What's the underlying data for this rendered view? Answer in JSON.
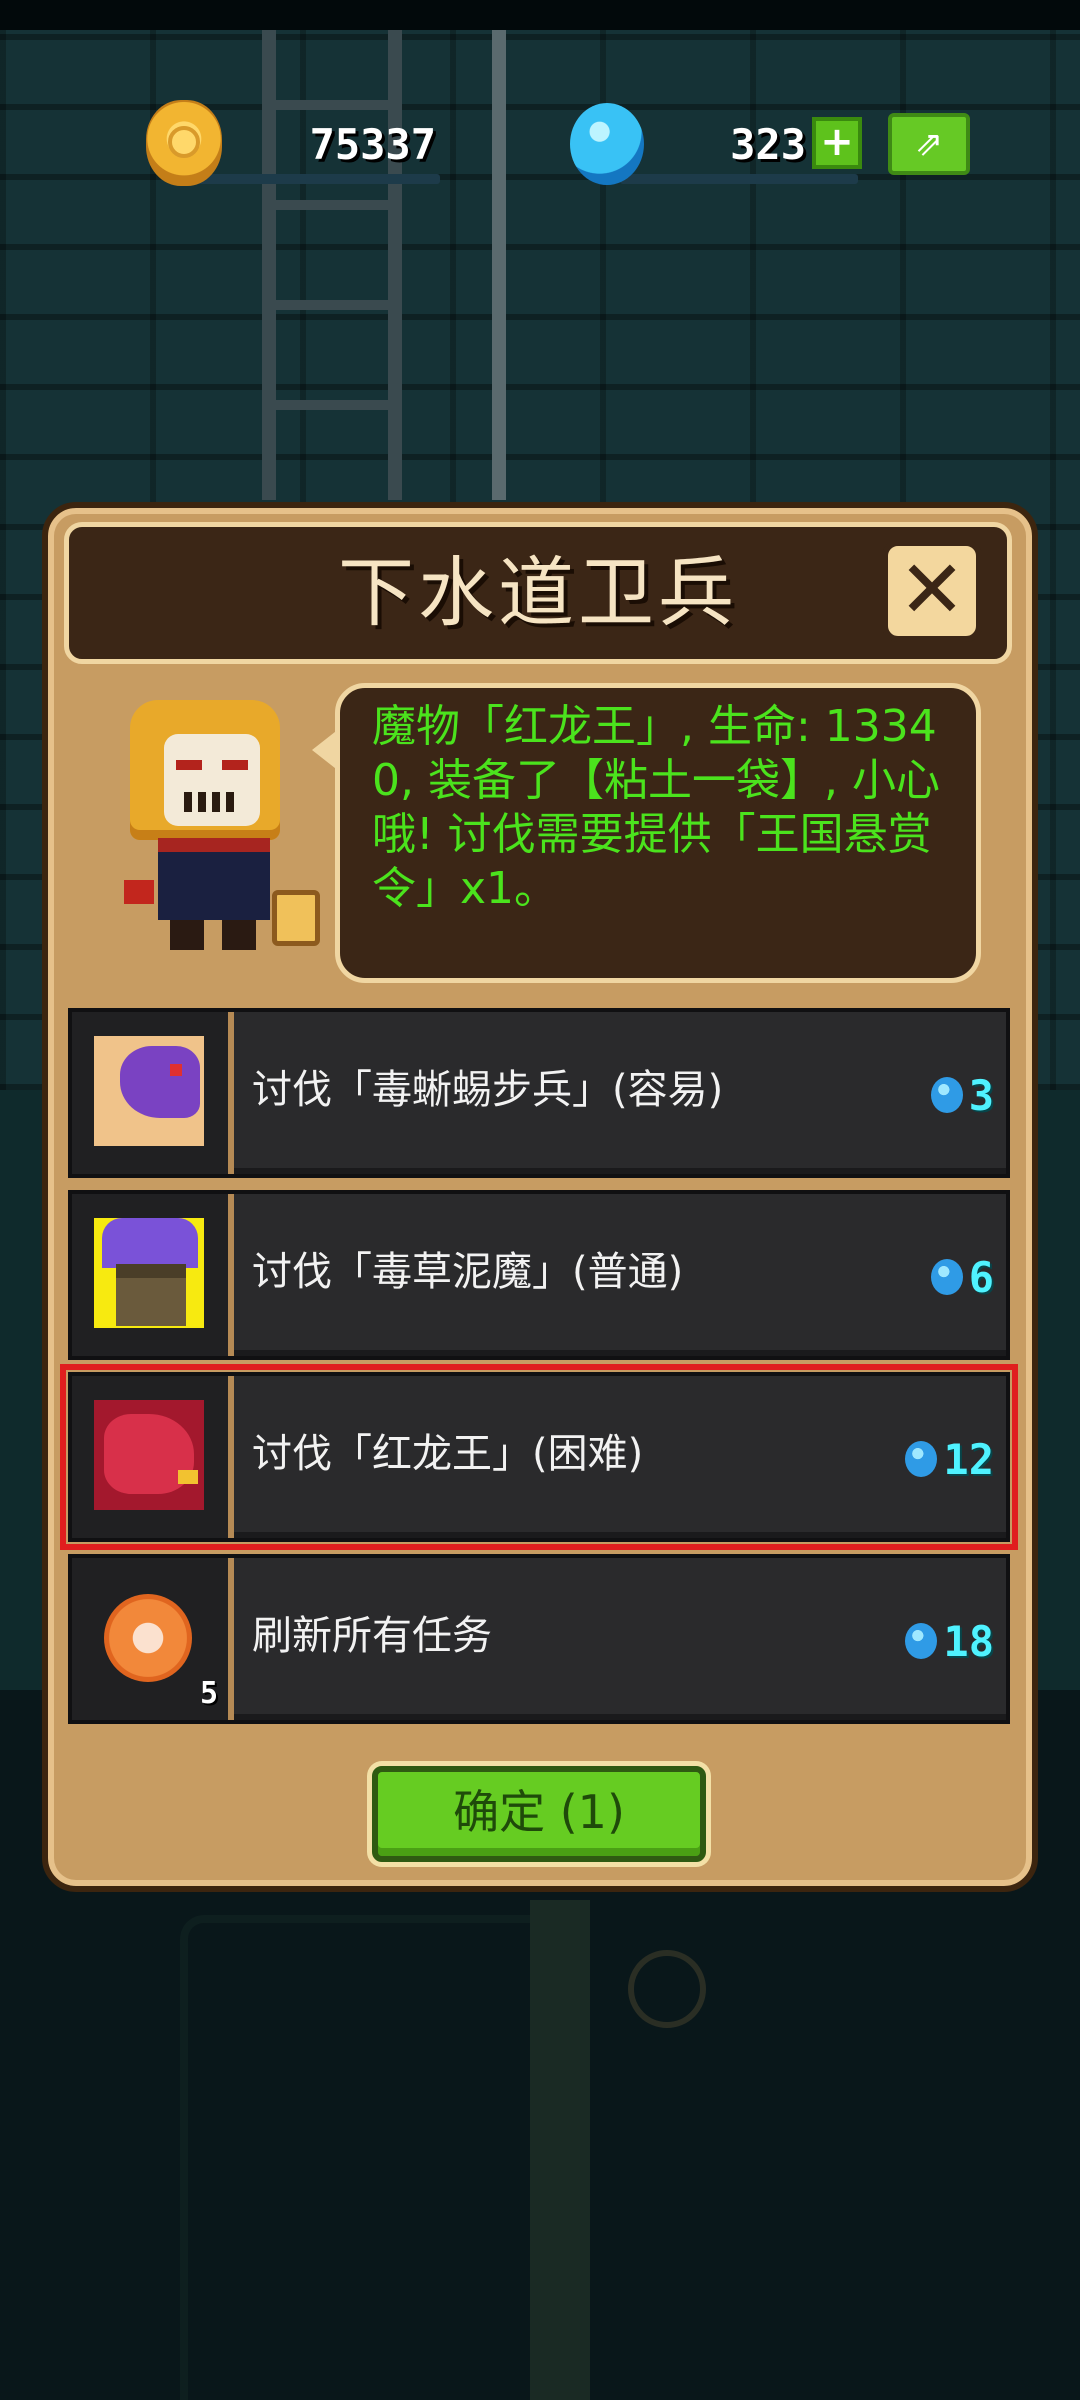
{
  "hud": {
    "coins": "75337",
    "gems": "323",
    "coin_icon": "gold-coin",
    "gem_icon": "blue-gem",
    "add_gems_label": "+",
    "share_icon": "share"
  },
  "dialog": {
    "title": "下水道卫兵",
    "close_icon": "close-x",
    "npc_icon": "golden-masked-guard",
    "speech": "魔物「红龙王」, 生命: 13340, 装备了【粘土一袋】, 小心哦!\n讨伐需要提供「王国悬赏令」x1。"
  },
  "quests": [
    {
      "label": "讨伐「毒蜥蜴步兵」(容易)",
      "cost": "3",
      "icon": "purple-lizard",
      "selected": false
    },
    {
      "label": "讨伐「毒草泥魔」(普通)",
      "cost": "6",
      "icon": "mud-monster",
      "selected": false
    },
    {
      "label": "讨伐「红龙王」(困难)",
      "cost": "12",
      "icon": "red-dragon",
      "selected": true
    },
    {
      "label": "刷新所有任务",
      "cost": "18",
      "icon": "refresh-token",
      "count": "5",
      "selected": false
    }
  ],
  "confirm_label": "确定 (1)",
  "colors": {
    "speech_text": "#4be31d",
    "cost_text": "#4ff2ff",
    "selected_outline": "#e01e1e",
    "confirm_bg": "#66cc22",
    "panel_bg": "#c79c62"
  }
}
